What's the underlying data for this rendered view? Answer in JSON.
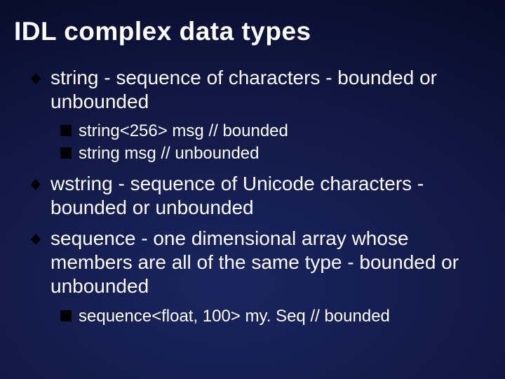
{
  "slide": {
    "title": "IDL complex data types",
    "items": [
      {
        "text": "string - sequence of characters - bounded or unbounded",
        "sub": [
          {
            "text": "string<256> msg   // bounded"
          },
          {
            "text": "string msg   // unbounded"
          }
        ]
      },
      {
        "text": "wstring - sequence of Unicode characters - bounded or unbounded",
        "sub": []
      },
      {
        "text": "sequence - one dimensional array whose members are all of the same type - bounded or unbounded",
        "sub": [
          {
            "text": "sequence<float, 100> my. Seq   // bounded"
          }
        ]
      }
    ]
  }
}
